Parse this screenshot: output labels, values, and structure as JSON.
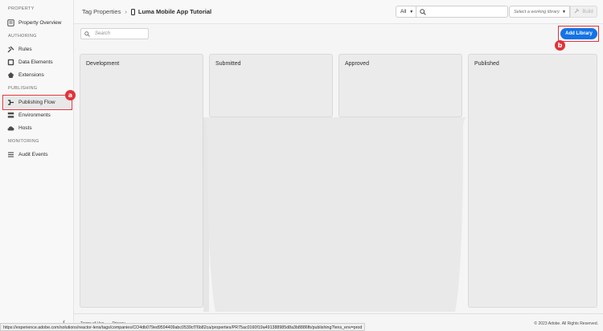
{
  "sidebar": {
    "sections": {
      "property": "PROPERTY",
      "authoring": "AUTHORING",
      "publishing": "PUBLISHING",
      "monitoring": "MONITORING"
    },
    "items": {
      "property_overview": "Property Overview",
      "rules": "Rules",
      "data_elements": "Data Elements",
      "extensions": "Extensions",
      "publishing_flow": "Publishing Flow",
      "environments": "Environments",
      "hosts": "Hosts",
      "audit_events": "Audit Events"
    },
    "active_item": "Publishing Flow",
    "collapse_glyph": "‹"
  },
  "header": {
    "breadcrumb_root": "Tag Properties",
    "property_name": "Luma Mobile App Tutorial",
    "filter_value": "All",
    "library_placeholder": "Select a working library",
    "build_label": "Build"
  },
  "toolbar": {
    "search_placeholder": "Search",
    "add_library_label": "Add Library"
  },
  "columns": {
    "development": "Development",
    "submitted": "Submitted",
    "approved": "Approved",
    "published": "Published"
  },
  "annotations": {
    "a": "a",
    "b": "b"
  },
  "footer": {
    "terms": "Terms of Use",
    "privacy": "Privacy",
    "copyright": "© 2023 Adobe. All Rights Reserved."
  },
  "status_url": "https://experience.adobe.com/solutions/reactor-lens/tags/companies/CO4db079ed9594409abc0539cf76b82ca/properties/PR75ac0160f19a491388985d8a3b8886fb/publishing?lens_env=prod",
  "colors": {
    "accent": "#1473e6",
    "annotation": "#e0333a"
  },
  "icons": [
    "property-overview-icon",
    "rules-icon",
    "data-elements-icon",
    "extensions-icon",
    "publishing-flow-icon",
    "environments-icon",
    "hosts-icon",
    "audit-events-icon",
    "phone-icon",
    "search-icon",
    "build-icon"
  ]
}
